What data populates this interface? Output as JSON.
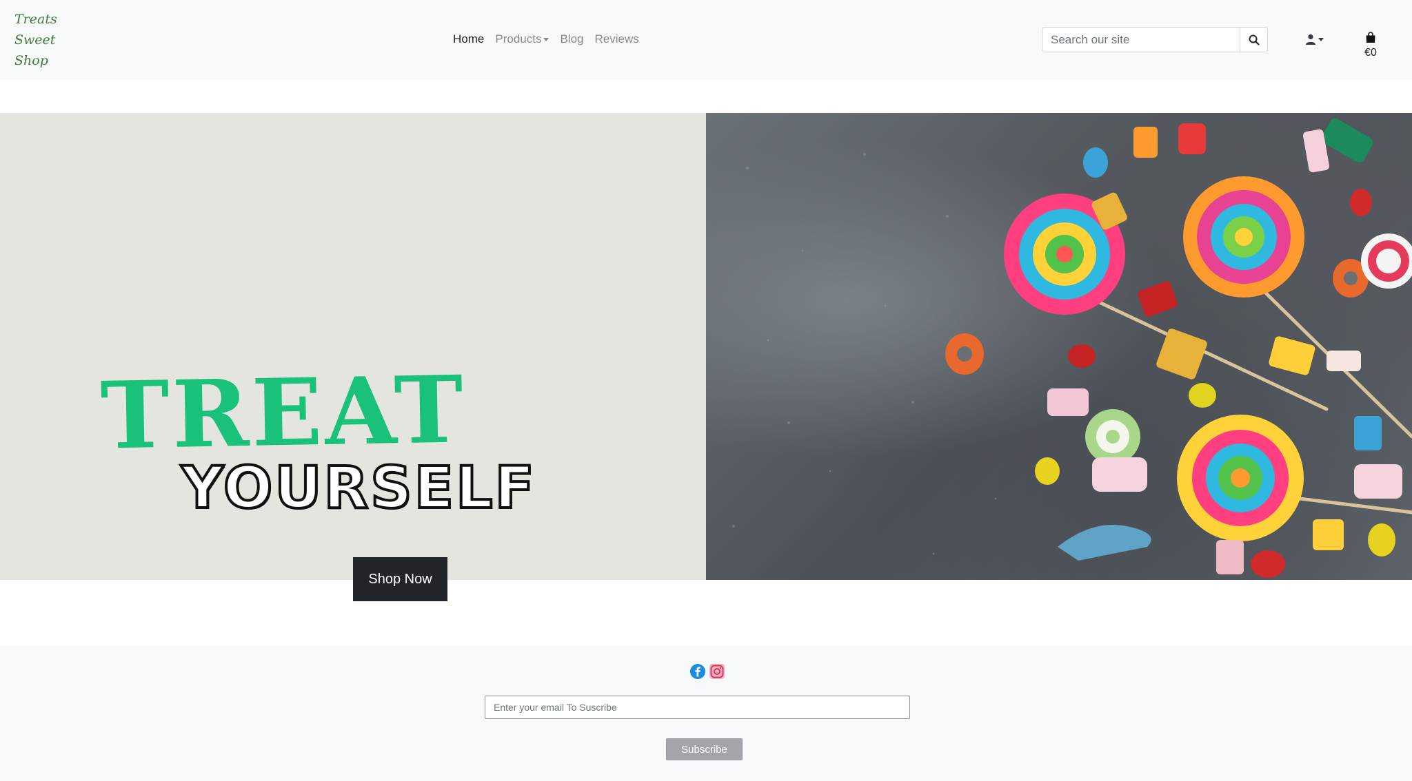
{
  "brand": {
    "line1": "Treats",
    "line2": "Sweet",
    "line3": "Shop"
  },
  "nav": {
    "home": "Home",
    "products": "Products",
    "blog": "Blog",
    "reviews": "Reviews"
  },
  "search": {
    "placeholder": "Search our site",
    "icon": "search-icon"
  },
  "account": {
    "icon": "user-icon"
  },
  "bag": {
    "icon": "shopping-bag-icon",
    "total": "€0"
  },
  "hero": {
    "headline_top": "TREAT",
    "headline_bottom": "YOURSELF",
    "cta": "Shop Now",
    "image": "lollipops-and-candies-on-grey-stone-background"
  },
  "footer": {
    "social": [
      "facebook-icon",
      "instagram-icon"
    ],
    "email_placeholder": "Enter your email To Suscribe",
    "subscribe": "Subscribe"
  },
  "colors": {
    "brand": "#3f7a3a",
    "accent_green": "#19c17a",
    "dark": "#212529",
    "hero_bg": "#e5e5e0",
    "facebook": "#1877f2",
    "instagram": "#e1306c"
  }
}
